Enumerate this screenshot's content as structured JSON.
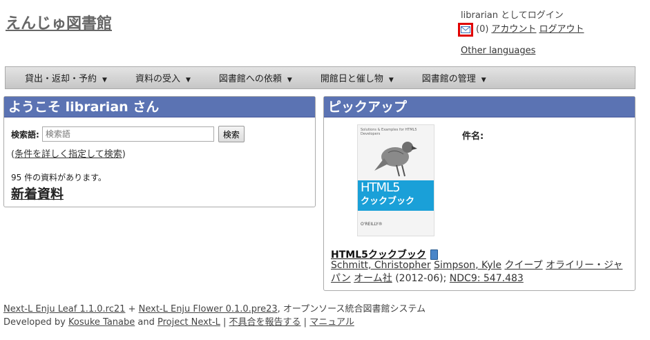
{
  "site": {
    "title": "えんじゅ図書館"
  },
  "login": {
    "status": "librarian としてログイン",
    "mail_count": "(0)",
    "account": "アカウント",
    "logout": "ログアウト",
    "other_languages": "Other languages"
  },
  "menu": [
    {
      "label": "貸出・返却・予約"
    },
    {
      "label": "資料の受入"
    },
    {
      "label": "図書館への依頼"
    },
    {
      "label": "開館日と催し物"
    },
    {
      "label": "図書館の管理"
    }
  ],
  "welcome": {
    "title": "ようこそ librarian さん",
    "search_label": "検索語:",
    "search_placeholder": "検索語",
    "search_button": "検索",
    "adv_open": "(",
    "adv_link": "条件を詳しく指定して検索",
    "adv_close": ")",
    "count_text": "95 件の資料があります。",
    "new_items": "新着資料"
  },
  "pickup": {
    "title": "ピックアップ",
    "subject_label": "件名:",
    "cover": {
      "top_text": "Solutions & Examples for HTML5 Developers",
      "line1": "HTML5",
      "line2": "クックブック",
      "foot_text": "O'REILLY®"
    },
    "book_title": "HTML5クックブック",
    "authors": [
      "Schmitt, Christopher",
      "Simpson, Kyle",
      "クイープ",
      "オライリー・ジャパン",
      "オーム社"
    ],
    "date": "(2012-06)",
    "sep": ";",
    "ndc": "NDC9: 547.483"
  },
  "footer": {
    "leaf": "Next-L Enju Leaf 1.1.0.rc21",
    "plus": "+",
    "flower": "Next-L Enju Flower 0.1.0.pre23",
    "desc": ", オープンソース統合図書館システム",
    "developed_by": "Developed by",
    "dev_name": "Kosuke Tanabe",
    "and": "and",
    "project": "Project Next-L",
    "pipe": "|",
    "report": "不具合を報告する",
    "manual": "マニュアル"
  },
  "colors": {
    "panel_header": "#5b73b3",
    "mail_highlight": "#e00000"
  }
}
